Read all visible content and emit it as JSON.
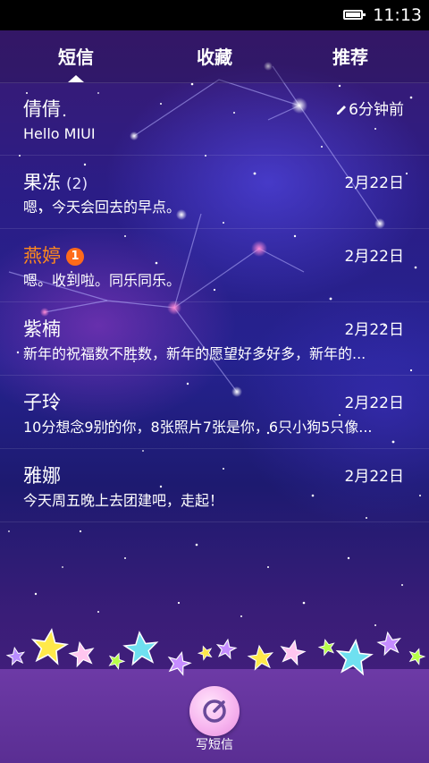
{
  "status_bar": {
    "time": "11:13",
    "battery_level": 1.0
  },
  "tabs": [
    {
      "label": "短信",
      "selected": true
    },
    {
      "label": "收藏",
      "selected": false
    },
    {
      "label": "推荐",
      "selected": false
    }
  ],
  "conversations": [
    {
      "contact": "倩倩",
      "count": "",
      "badge": "",
      "date": "6分钟前",
      "preview": "Hello MIUI",
      "unread": false,
      "draft_icon": "pencil-icon"
    },
    {
      "contact": "果冻",
      "count": "(2)",
      "badge": "",
      "date": "2月22日",
      "preview": "嗯，今天会回去的早点。",
      "unread": false
    },
    {
      "contact": "燕婷",
      "count": "",
      "badge": "1",
      "date": "2月22日",
      "preview": "嗯。收到啦。同乐同乐。",
      "unread": true
    },
    {
      "contact": "紫楠",
      "count": "",
      "badge": "",
      "date": "2月22日",
      "preview": "新年的祝福数不胜数，新年的愿望好多好多，新年的...",
      "unread": false
    },
    {
      "contact": "子玲",
      "count": "",
      "badge": "",
      "date": "2月22日",
      "preview": "10分想念9别的你，8张照片7张是你，6只小狗5只像...",
      "unread": false
    },
    {
      "contact": "雅娜",
      "count": "",
      "badge": "",
      "date": "2月22日",
      "preview": "今天周五晚上去团建吧，走起！",
      "unread": false
    }
  ],
  "compose": {
    "label": "写短信",
    "icon": "compose-icon"
  },
  "colors": {
    "unread_name": "#ff8a1c",
    "badge": "#ff6a1a",
    "bottom_bar": "#6d3aa6",
    "compose_button": "#f7b5ef"
  }
}
